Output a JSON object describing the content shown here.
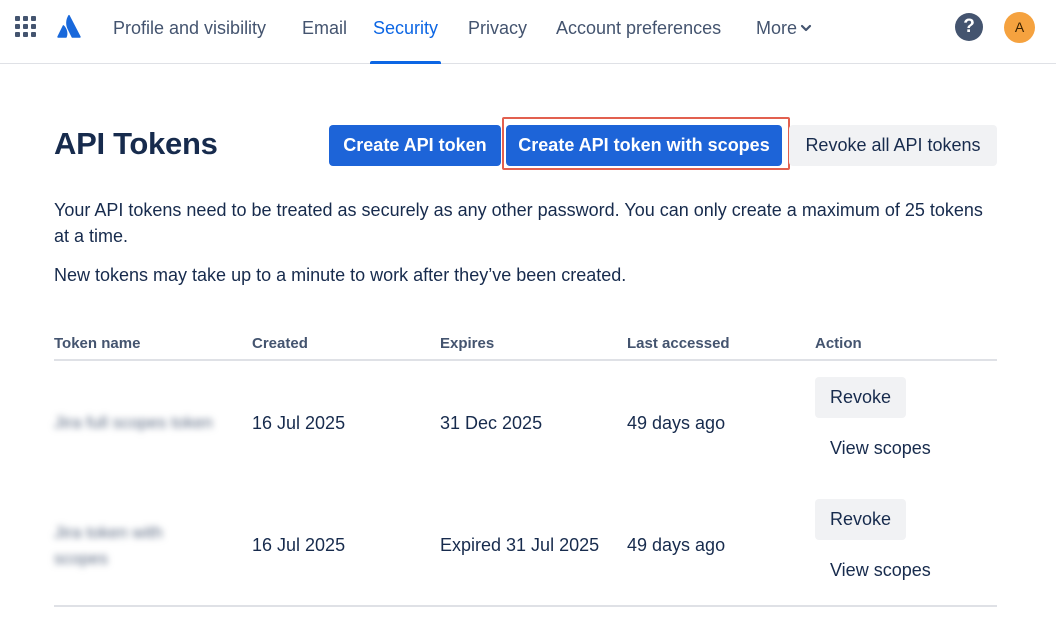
{
  "nav": {
    "apps_icon": "app-switcher-grid-icon",
    "logo_icon": "atlassian-logo-icon",
    "tabs": [
      {
        "label": "Profile and visibility",
        "active": false
      },
      {
        "label": "Email",
        "active": false
      },
      {
        "label": "Security",
        "active": true
      },
      {
        "label": "Privacy",
        "active": false
      },
      {
        "label": "Account preferences",
        "active": false
      },
      {
        "label": "More",
        "active": false
      }
    ],
    "help_icon": "?",
    "avatar_initial": "A"
  },
  "page": {
    "title": "API Tokens",
    "buttons": {
      "create": "Create API token",
      "create_scoped": "Create API token with scopes",
      "revoke_all": "Revoke all API tokens"
    },
    "description_1": "Your API tokens need to be treated as securely as any other password. You can only create a maximum of 25 tokens at a time.",
    "description_2": "New tokens may take up to a minute to work after they’ve been created."
  },
  "table": {
    "headers": [
      "Token name",
      "Created",
      "Expires",
      "Last accessed",
      "Action"
    ],
    "rows": [
      {
        "name": "Jira full scopes token",
        "created": "16 Jul 2025",
        "expires": "31 Dec 2025",
        "last_accessed": "49 days ago",
        "revoke": "Revoke",
        "view_scopes": "View scopes"
      },
      {
        "name": "Jira token with scopes",
        "created": "16 Jul 2025",
        "expires": "Expired 31 Jul 2025",
        "last_accessed": "49 days ago",
        "revoke": "Revoke",
        "view_scopes": "View scopes"
      }
    ]
  },
  "colors": {
    "brand_blue": "#0c66e4",
    "primary_button": "#1d64d8",
    "highlight_border": "#e2604f",
    "avatar_bg": "#f5a23f"
  }
}
